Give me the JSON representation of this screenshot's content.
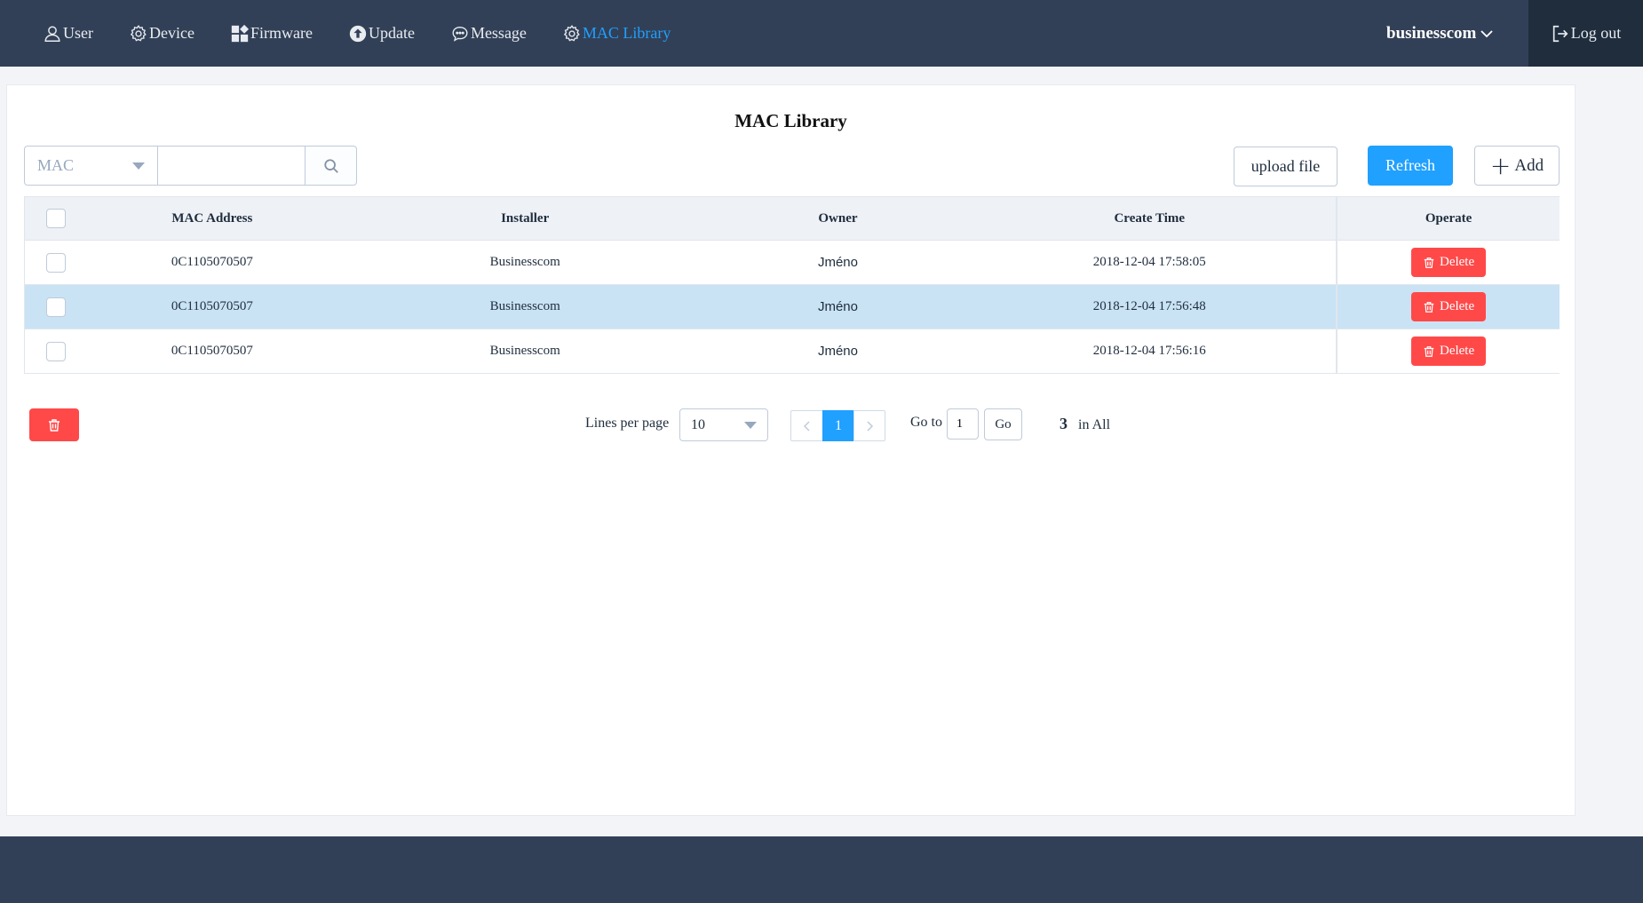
{
  "nav": {
    "items": [
      {
        "label": "User",
        "icon": "user-icon"
      },
      {
        "label": "Device",
        "icon": "gear-icon"
      },
      {
        "label": "Firmware",
        "icon": "grid-icon"
      },
      {
        "label": "Update",
        "icon": "upload-circle-icon"
      },
      {
        "label": "Message",
        "icon": "chat-bubble-icon"
      },
      {
        "label": "MAC Library",
        "icon": "gear-icon"
      }
    ],
    "active": "MAC Library",
    "user": "businesscom",
    "logout": "Log out"
  },
  "page": {
    "title": "MAC Library"
  },
  "search": {
    "field_selected": "MAC",
    "query": ""
  },
  "actions": {
    "upload": "upload file",
    "refresh": "Refresh",
    "add": "Add"
  },
  "table": {
    "columns": [
      "MAC Address",
      "Installer",
      "Owner",
      "Create Time",
      "Operate"
    ],
    "rows": [
      {
        "mac": "0C1105070507",
        "installer": "Businesscom",
        "owner": "Jméno",
        "time": "2018-12-04 17:58:05",
        "op": "Delete"
      },
      {
        "mac": "0C1105070507",
        "installer": "Businesscom",
        "owner": "Jméno",
        "time": "2018-12-04 17:56:48",
        "op": "Delete"
      },
      {
        "mac": "0C1105070507",
        "installer": "Businesscom",
        "owner": "Jméno",
        "time": "2018-12-04 17:56:16",
        "op": "Delete"
      }
    ]
  },
  "pagination": {
    "lines_label": "Lines per page",
    "page_size": "10",
    "current_page": "1",
    "goto_label": "Go to",
    "goto_value": "1",
    "go_button": "Go",
    "total": "3",
    "total_suffix": "in All"
  },
  "colors": {
    "nav_bg": "#324057",
    "accent": "#20a0ff",
    "danger": "#ff4949",
    "row_highlight": "#c9e3f5"
  }
}
